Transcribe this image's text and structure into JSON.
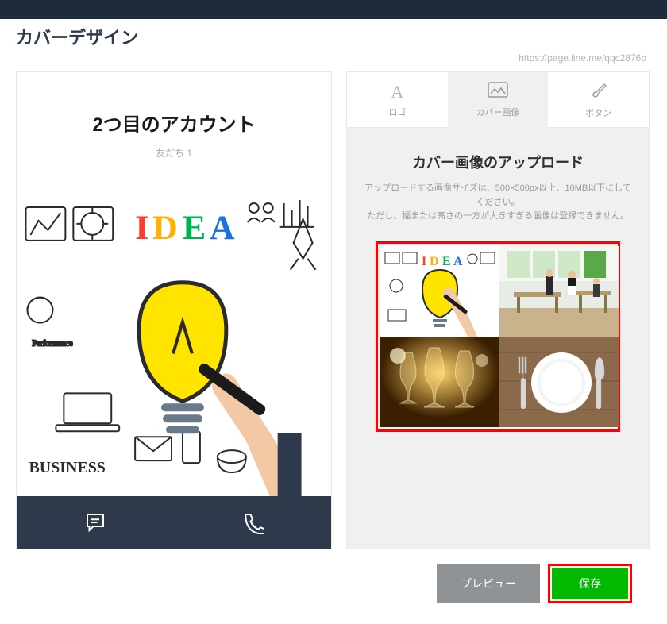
{
  "page": {
    "title": "カバーデザイン",
    "url_hint": "https://page.line.me/qqc2876p"
  },
  "preview": {
    "account_name": "2つ目のアカウント",
    "friends_label": "友だち 1"
  },
  "tabs": {
    "logo": "ロゴ",
    "cover": "カバー画像",
    "button": "ボタン"
  },
  "upload": {
    "title": "カバー画像のアップロード",
    "desc_line1": "アップロードする画像サイズは、500×500px以上、10MB以下にしてください。",
    "desc_line2": "ただし、幅または高さの一方が大きすぎる画像は登録できません。"
  },
  "buttons": {
    "preview": "プレビュー",
    "save": "保存"
  },
  "icons": {
    "chat": "chat-icon",
    "phone": "phone-icon",
    "logo_tab": "A",
    "image_tab": "image-icon",
    "brush_tab": "brush-icon"
  },
  "cover_image": {
    "concept": "IDEA",
    "elements": [
      "lightbulb",
      "hand-drawing",
      "business-doodles",
      "charts",
      "rocket",
      "laptop",
      "gears"
    ]
  },
  "thumbnails": [
    {
      "name": "idea-doodle",
      "selected": true
    },
    {
      "name": "office-interior"
    },
    {
      "name": "wine-glasses"
    },
    {
      "name": "plate-cutlery"
    }
  ]
}
